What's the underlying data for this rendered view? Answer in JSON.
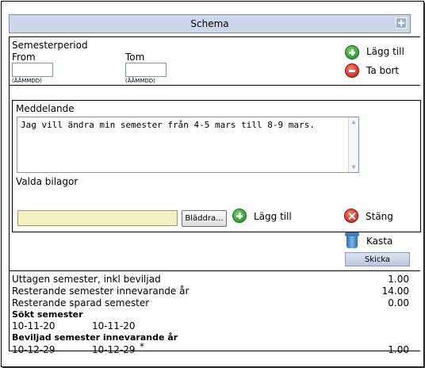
{
  "header": {
    "title": "Schema",
    "expand_icon": "plus-box-icon"
  },
  "period": {
    "title": "Semesterperiod",
    "from_label": "From",
    "to_label": "Tom",
    "from_value": "",
    "to_value": "",
    "from_hint": "(ÅÅMMDD)",
    "to_hint": "(ÅÅMMDD)",
    "add_label": "Lägg till",
    "remove_label": "Ta bort"
  },
  "message": {
    "title": "Meddelande",
    "text": "Jag vill ändra min semester från 4-5 mars till 8-9 mars.",
    "attachments_title": "Valda bilagor",
    "file_value": "",
    "browse_label": "Bläddra...",
    "add_label": "Lägg till",
    "close_label": "Stäng"
  },
  "actions": {
    "discard_label": "Kasta",
    "send_label": "Skicka"
  },
  "summary": {
    "rows": [
      {
        "label": "Uttagen semester, inkl beviljad",
        "value": "1.00"
      },
      {
        "label": "Resterande semester innevarande år",
        "value": "14.00"
      },
      {
        "label": "Resterande sparad semester",
        "value": "0.00"
      }
    ],
    "requested_title": "Sökt semester",
    "requested_from": "10-11-20",
    "requested_to": "10-11-20",
    "approved_title": "Beviljad semester innevarande år",
    "approved_from": "10-12-29",
    "approved_to": "10-12-29",
    "approved_mark": "*",
    "approved_value": "1.00"
  },
  "colors": {
    "header_bg": "#cdd7ea",
    "file_input_bg": "#f2f0c0",
    "add_green": "#2a9a2a",
    "remove_red": "#d0180c"
  }
}
